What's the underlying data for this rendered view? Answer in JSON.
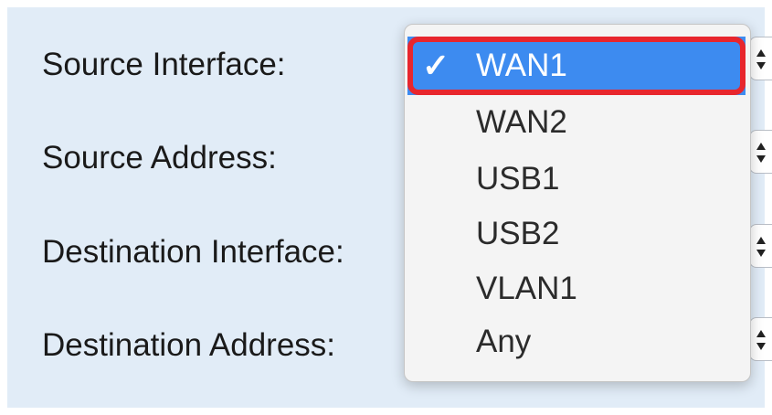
{
  "form": {
    "fields": [
      {
        "label": "Source Interface:"
      },
      {
        "label": "Source Address:"
      },
      {
        "label": "Destination Interface:"
      },
      {
        "label": "Destination Address:"
      }
    ]
  },
  "dropdown": {
    "selected_mark": "✓",
    "selected": "WAN1",
    "options": [
      "WAN1",
      "WAN2",
      "USB1",
      "USB2",
      "VLAN1",
      "Any"
    ]
  },
  "colors": {
    "panel_bg": "#e1ecf7",
    "selection_blue": "#3d8bf0",
    "highlight_red": "#e8262d"
  },
  "icons": {
    "stepper": "up-down-stepper-icon",
    "check": "checkmark-icon"
  }
}
